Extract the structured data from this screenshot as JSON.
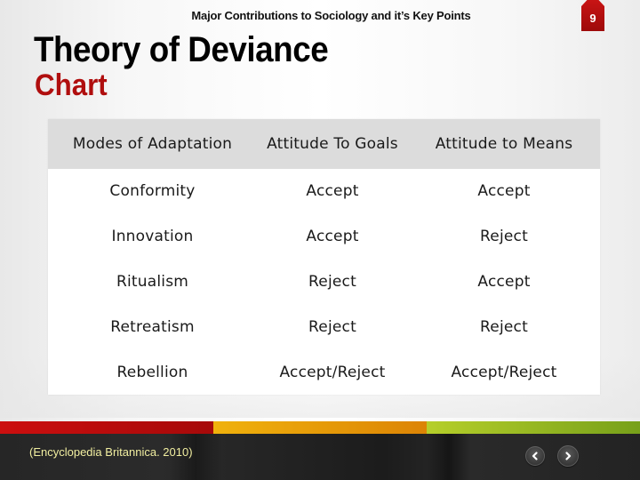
{
  "header": {
    "subtitle": "Major Contributions to Sociology and it’s Key Points",
    "title": "Theory of Deviance",
    "title_sub": "Chart",
    "page_number": "9"
  },
  "table": {
    "columns": [
      "Modes of Adaptation",
      "Attitude To Goals",
      "Attitude to Means"
    ],
    "rows": [
      [
        "Conformity",
        "Accept",
        "Accept"
      ],
      [
        "Innovation",
        "Accept",
        "Reject"
      ],
      [
        "Ritualism",
        "Reject",
        "Accept"
      ],
      [
        "Retreatism",
        "Reject",
        "Reject"
      ],
      [
        "Rebellion",
        "Accept/Reject",
        "Accept/Reject"
      ]
    ]
  },
  "footer": {
    "citation": "(Encyclopedia Britannica. 2010)",
    "prev_icon": "chevron-left-icon",
    "next_icon": "chevron-right-icon"
  },
  "colors": {
    "accent_red": "#b00e0e",
    "stripe_red": "#cc0f0f",
    "stripe_orange": "#f0b20c",
    "stripe_green": "#8cb020",
    "header_row_bg": "#dcdcdc",
    "citation_text": "#f1eea0"
  }
}
